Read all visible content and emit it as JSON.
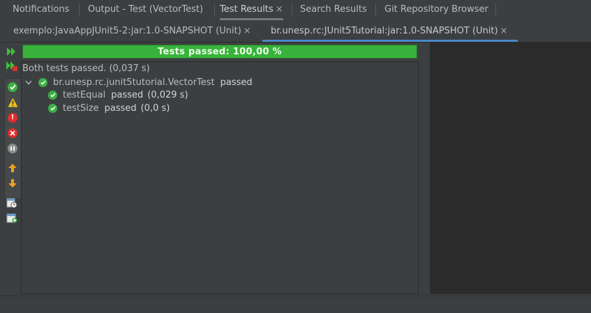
{
  "top_tabs": [
    {
      "label": "Notifications"
    },
    {
      "label": "Output - Test (VectorTest)"
    },
    {
      "label": "Test Results",
      "close": "×"
    },
    {
      "label": "Search Results"
    },
    {
      "label": "Git Repository Browser"
    }
  ],
  "sub_tabs": [
    {
      "label": "exemplo:JavaAppJUnit5-2:jar:1.0-SNAPSHOT (Unit)",
      "close": "×"
    },
    {
      "label": "br.unesp.rc:JUnit5Tutorial:jar:1.0-SNAPSHOT (Unit)",
      "close": "×"
    }
  ],
  "toolbar": {
    "icons": [
      "rerun-icon",
      "rerun-failed-icon",
      "show-passed-icon",
      "show-warnings-icon",
      "show-errors-icon",
      "show-failures-icon",
      "show-aborted-icon",
      "previous-failure-icon",
      "next-failure-icon",
      "sort-by-time-icon",
      "new-test-icon"
    ]
  },
  "progress": {
    "label": "Tests passed: 100,00 %",
    "percent": 100,
    "color": "#38b23b"
  },
  "results": {
    "summary": "Both tests passed. (0,037 s)",
    "suite": {
      "name": "br.unesp.rc.junit5tutorial.VectorTest",
      "status": "passed"
    },
    "tests": [
      {
        "name": "testEqual",
        "status": "passed",
        "time": "(0,029 s)"
      },
      {
        "name": "testSize",
        "status": "passed",
        "time": "(0,0 s)"
      }
    ]
  },
  "colors": {
    "pass": "#3cb043",
    "warning": "#f0c020",
    "error": "#e02d2d",
    "accent": "#4a88c7"
  }
}
